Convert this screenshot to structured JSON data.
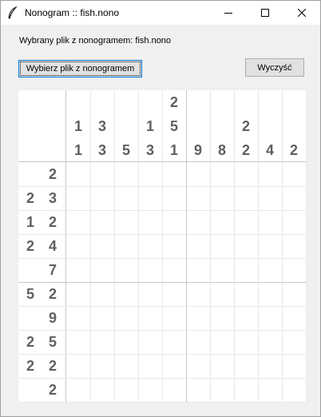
{
  "window": {
    "title": "Nonogram :: fish.nono",
    "icon": "feather-icon",
    "minimize": "—",
    "maximize": "☐",
    "close": "✕"
  },
  "file_label": "Wybrany plik z nonogramem: fish.nono",
  "buttons": {
    "choose_file": "Wybierz plik z nonogramem",
    "clear": "Wyczyść"
  },
  "puzzle": {
    "size": 10,
    "column_clues": [
      [
        "1",
        "1"
      ],
      [
        "3",
        "3"
      ],
      [
        "5"
      ],
      [
        "1",
        "3"
      ],
      [
        "2",
        "5",
        "1"
      ],
      [
        "9"
      ],
      [
        "8"
      ],
      [
        "2",
        "2"
      ],
      [
        "4"
      ],
      [
        "2"
      ]
    ],
    "row_clues": [
      [
        "2"
      ],
      [
        "2",
        "3"
      ],
      [
        "1",
        "2"
      ],
      [
        "2",
        "4"
      ],
      [
        "7"
      ],
      [
        "5",
        "2"
      ],
      [
        "9"
      ],
      [
        "2",
        "5"
      ],
      [
        "2",
        "2"
      ],
      [
        "2"
      ]
    ]
  }
}
